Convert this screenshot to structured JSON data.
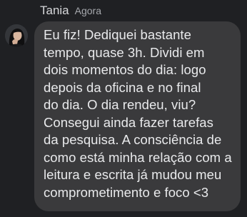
{
  "message": {
    "sender": "Tania",
    "time": "Agora",
    "text": "Eu fiz! Dediquei bastante\ntempo, quase 3h. Dividi em\ndois momentos do dia: logo\ndepois da oficina e no final\ndo dia. O dia rendeu, viu?\nConsegui ainda fazer tarefas\nda pesquisa. A consciência de\ncomo está minha relação com a\nleitura e escrita já mudou meu\ncomprometimento e foco <3"
  },
  "colors": {
    "background": "#1f2023",
    "bubble": "#3a3a3c",
    "text": "#e9eaec",
    "meta": "#a6a8ad"
  }
}
